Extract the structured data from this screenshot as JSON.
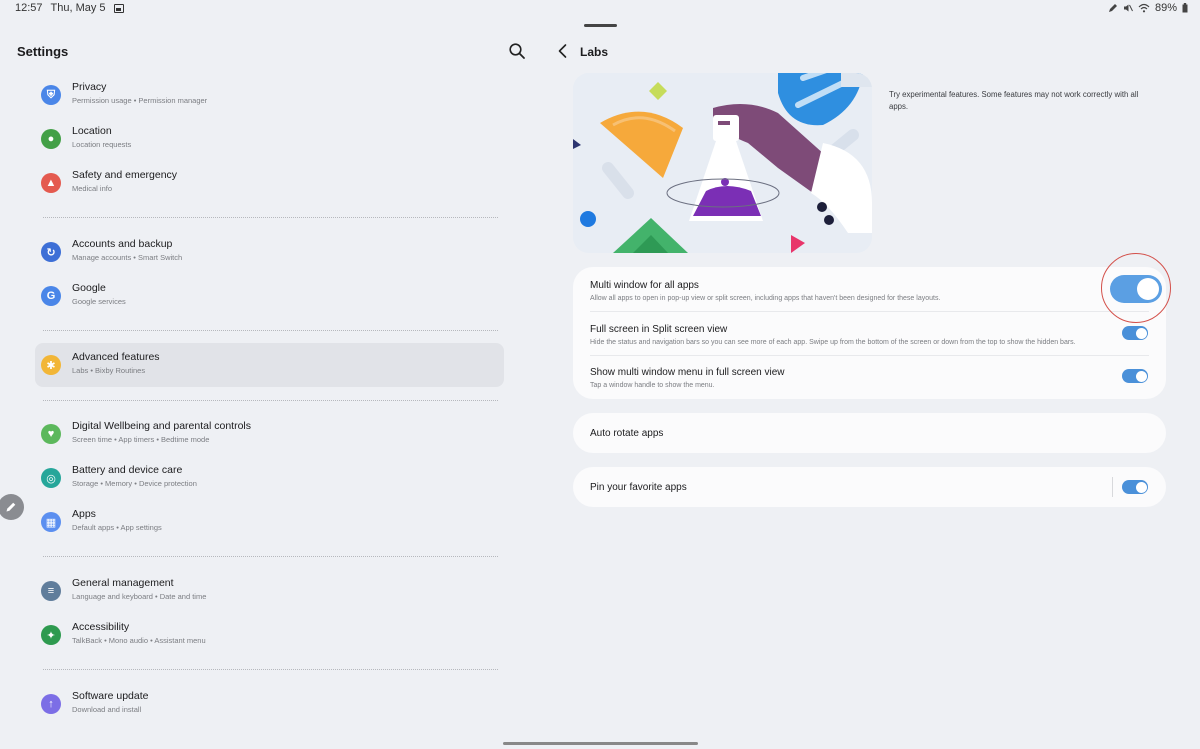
{
  "status_bar": {
    "time": "12:57",
    "date": "Thu, May 5",
    "battery": "89%"
  },
  "left": {
    "title": "Settings",
    "items": [
      {
        "title": "Privacy",
        "subtitle": "Permission usage  •  Permission manager",
        "icon": "privacy-shield-icon",
        "color": "#4a86e8"
      },
      {
        "title": "Location",
        "subtitle": "Location requests",
        "icon": "location-pin-icon",
        "color": "#43a047"
      },
      {
        "title": "Safety and emergency",
        "subtitle": "Medical info",
        "icon": "emergency-icon",
        "color": "#e45a4f"
      },
      {
        "title": "Accounts and backup",
        "subtitle": "Manage accounts  •  Smart Switch",
        "icon": "sync-icon",
        "color": "#3d6fd6"
      },
      {
        "title": "Google",
        "subtitle": "Google services",
        "icon": "google-icon",
        "color": "#4a86e8"
      },
      {
        "title": "Advanced features",
        "subtitle": "Labs  •  Bixby Routines",
        "icon": "puzzle-gear-icon",
        "color": "#f2b637"
      },
      {
        "title": "Digital Wellbeing and parental controls",
        "subtitle": "Screen time  •  App timers  •  Bedtime mode",
        "icon": "wellbeing-heart-icon",
        "color": "#5cb85c"
      },
      {
        "title": "Battery and device care",
        "subtitle": "Storage  •  Memory  •  Device protection",
        "icon": "device-care-icon",
        "color": "#26a69a"
      },
      {
        "title": "Apps",
        "subtitle": "Default apps  •  App settings",
        "icon": "apps-grid-icon",
        "color": "#5b8ff0"
      },
      {
        "title": "General management",
        "subtitle": "Language and keyboard  •  Date and time",
        "icon": "sliders-icon",
        "color": "#607d9b"
      },
      {
        "title": "Accessibility",
        "subtitle": "TalkBack  •  Mono audio  •  Assistant menu",
        "icon": "accessibility-person-icon",
        "color": "#2e9a4f"
      },
      {
        "title": "Software update",
        "subtitle": "Download and install",
        "icon": "software-update-icon",
        "color": "#7c6ee6"
      }
    ]
  },
  "right": {
    "title": "Labs",
    "description": "Try experimental features. Some features may not work correctly with all apps.",
    "group1": [
      {
        "title": "Multi window for all apps",
        "subtitle": "Allow all apps to open in pop-up view or split screen, including apps that haven't been designed for these layouts.",
        "enabled": true
      },
      {
        "title": "Full screen in Split screen view",
        "subtitle": "Hide the status and navigation bars so you can see more of each app. Swipe up from the bottom of the screen or down from the top to show the hidden bars.",
        "enabled": true
      },
      {
        "title": "Show multi window menu in full screen view",
        "subtitle": "Tap a window handle to show the menu.",
        "enabled": true
      }
    ],
    "auto_rotate": {
      "title": "Auto rotate apps"
    },
    "pin_apps": {
      "title": "Pin your favorite apps",
      "enabled": true
    }
  },
  "colors": {
    "accent": "#4a90d9",
    "highlight_ring": "#d3504a",
    "background": "#eef0f4"
  }
}
